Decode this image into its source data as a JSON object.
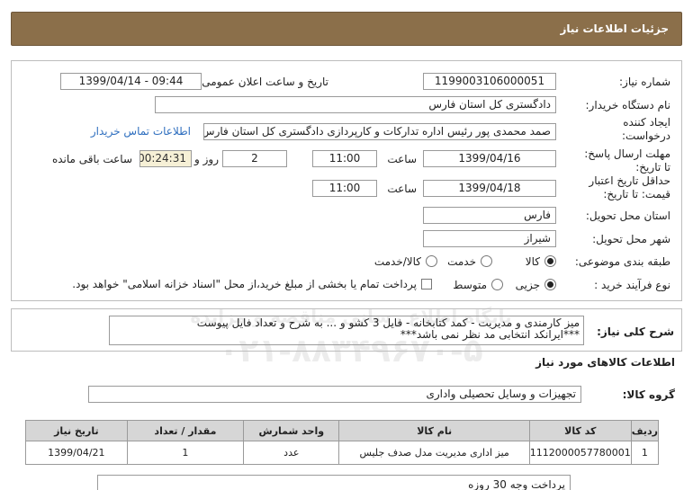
{
  "header": {
    "title": "جزئیات اطلاعات نیاز"
  },
  "fields": {
    "need_number_label": "شماره نیاز:",
    "need_number": "1199003106000051",
    "announce_label": "تاریخ و ساعت اعلان عمومی:",
    "announce_value": "1399/04/14 - 09:44",
    "buyer_label": "نام دستگاه خریدار:",
    "buyer_value": "دادگستری کل استان فارس",
    "creator_label_1": "ایجاد کننده",
    "creator_label_2": "درخواست:",
    "creator_value": "صمد محمدی پور رئیس اداره تدارکات و کارپردازی دادگستری کل استان فارس",
    "contact_link": "اطلاعات تماس خریدار",
    "deadline_label_1": "مهلت ارسال پاسخ:",
    "deadline_label_2": "تا تاریخ:",
    "deadline_date": "1399/04/16",
    "time_label": "ساعت",
    "deadline_time": "11:00",
    "days_value": "2",
    "days_label": "روز و",
    "remaining_time": "00:24:31",
    "remaining_label": "ساعت باقی مانده",
    "validity_label_1": "حداقل تاریخ اعتبار",
    "validity_label_2": "قیمت: تا تاریخ:",
    "validity_date": "1399/04/18",
    "validity_time": "11:00",
    "province_label": "استان محل تحویل:",
    "province_value": "فارس",
    "city_label": "شهر محل تحویل:",
    "city_value": "شیراز",
    "category_label": "طبقه بندی موضوعی:",
    "category_options": [
      "کالا",
      "خدمت",
      "کالا/خدمت"
    ],
    "process_label": "نوع فرآیند خرید :",
    "process_options": [
      "جزیی",
      "متوسط"
    ],
    "payment_note": "پرداخت تمام یا بخشی از مبلغ خرید،از محل \"اسناد خزانه اسلامی\" خواهد بود."
  },
  "description": {
    "label": "شرح کلی نیاز:",
    "line1": "میز کارمندی و مدیریت - کمد کتابخانه - فایل 3 کشو و ... به شرح و تعداد فایل پیوست",
    "line2": "***ایرانکد انتخابی مد نظر نمی باشد***"
  },
  "goods": {
    "section_title": "اطلاعات کالاهای مورد نیاز",
    "group_label": "گروه کالا:",
    "group_value": "تجهیزات و وسایل تحصیلی واداری",
    "columns": [
      "ردیف",
      "کد کالا",
      "نام کالا",
      "واحد شمارش",
      "مقدار / تعداد",
      "تاریخ نیاز"
    ],
    "rows": [
      [
        "1",
        "1112000057780001",
        "میز اداری مدیریت مدل صدف جلیس",
        "عدد",
        "1",
        "1399/04/21"
      ]
    ]
  },
  "footer": {
    "note": "پرداخت وجه 30 روزه"
  },
  "watermark": {
    "brand": "ParsNamadData",
    "phone": "۰۲۱-۸۸۳۴۹۶۷۰-۵",
    "tagline": "پایگاه اطلاع رسانی مناقصه و مزایده"
  }
}
